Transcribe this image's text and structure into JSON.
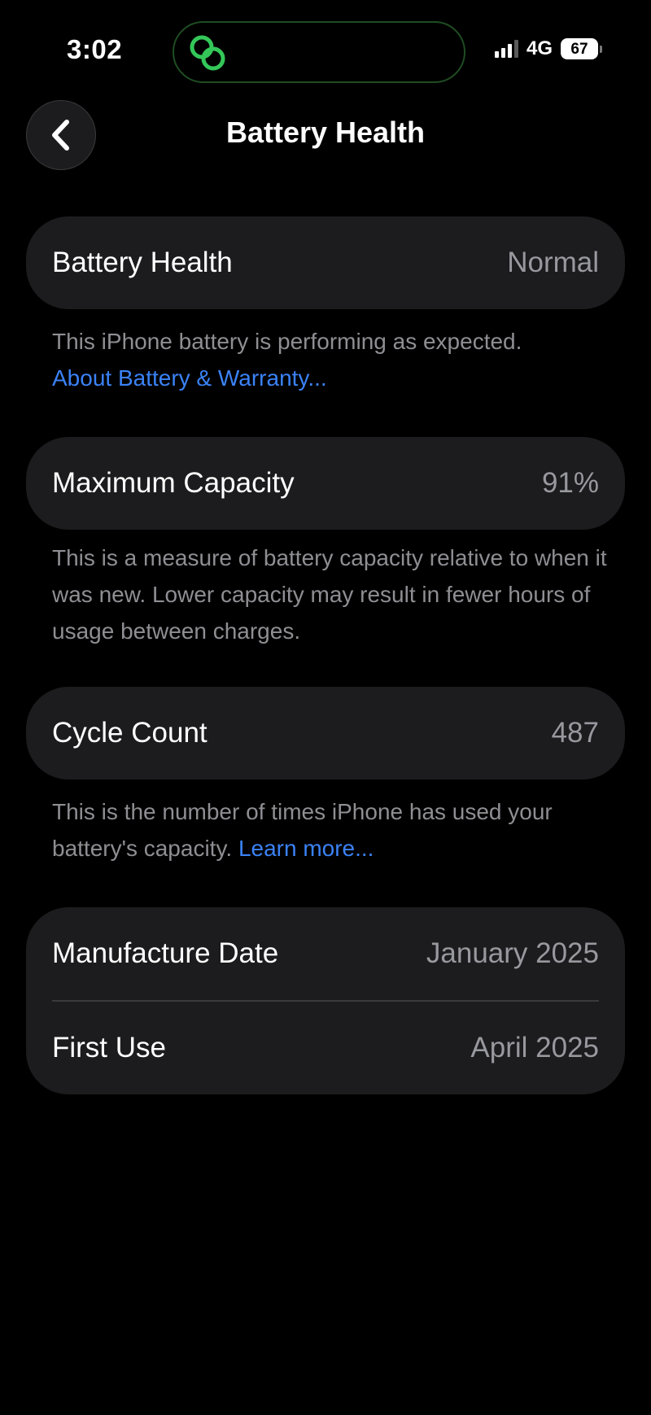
{
  "status_bar": {
    "time": "3:02",
    "network": "4G",
    "battery_level": "67",
    "signal_bars_filled": 3,
    "signal_bars_total": 4,
    "island_icon": "link-rings-icon",
    "island_accent": "#34c759"
  },
  "nav": {
    "back_icon": "chevron-left-icon",
    "title": "Battery Health"
  },
  "battery_health": {
    "label": "Battery Health",
    "value": "Normal",
    "description": "This iPhone battery is performing as expected.",
    "link": "About Battery & Warranty..."
  },
  "maximum_capacity": {
    "label": "Maximum Capacity",
    "value": "91%",
    "description": "This is a measure of battery capacity relative to when it was new. Lower capacity may result in fewer hours of usage between charges."
  },
  "cycle_count": {
    "label": "Cycle Count",
    "value": "487",
    "description": "This is the number of times iPhone has used your battery's capacity.",
    "link": "Learn more..."
  },
  "dates": {
    "manufacture_label": "Manufacture Date",
    "manufacture_value": "January 2025",
    "first_use_label": "First Use",
    "first_use_value": "April 2025"
  },
  "colors": {
    "background": "#000000",
    "card": "#1c1c1e",
    "secondary_text": "#98989f",
    "link": "#3b82f6"
  }
}
